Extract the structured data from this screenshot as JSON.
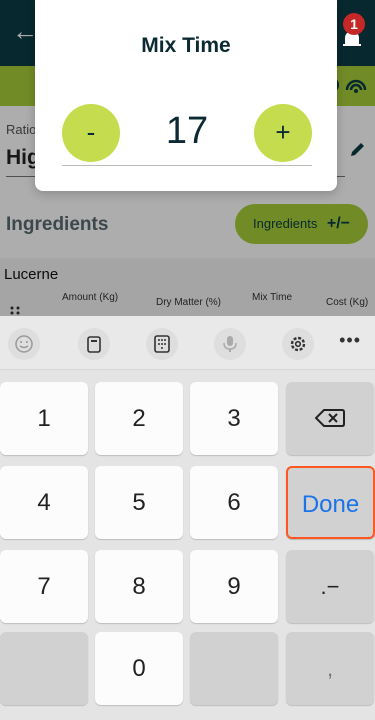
{
  "app": {
    "back_glyph": "←",
    "notification_count": "1",
    "ration_label": "Ratio",
    "ration_value": "Hig",
    "ingredients_title": "Ingredients",
    "ingredients_button": "Ingredients",
    "ingredients_button_icon": "+/−",
    "card": {
      "name": "Lucerne",
      "columns": [
        "Amount (Kg)",
        "Dry Matter (%)",
        "Mix Time",
        "Cost (Kg)"
      ]
    },
    "colors": {
      "header": "#0b3b44",
      "accent": "#a7cf3a"
    }
  },
  "dialog": {
    "title": "Mix Time",
    "minus_label": "-",
    "plus_label": "+",
    "value": "17",
    "button_color": "#c5dc4e"
  },
  "keyboard": {
    "toolbar_icons": [
      "emoji-icon",
      "clipboard-icon",
      "keypad-icon",
      "microphone-icon",
      "settings-icon",
      "more-icon"
    ],
    "more_label": "•••",
    "keys": {
      "k1": "1",
      "k2": "2",
      "k3": "3",
      "k4": "4",
      "k5": "5",
      "k6": "6",
      "k7": "7",
      "k8": "8",
      "k9": "9",
      "k0": "0",
      "done": "Done",
      "dot_minus": ".−",
      "comma": ","
    },
    "done_highlight_color": "#ff5722",
    "done_text_color": "#1a73e8"
  }
}
